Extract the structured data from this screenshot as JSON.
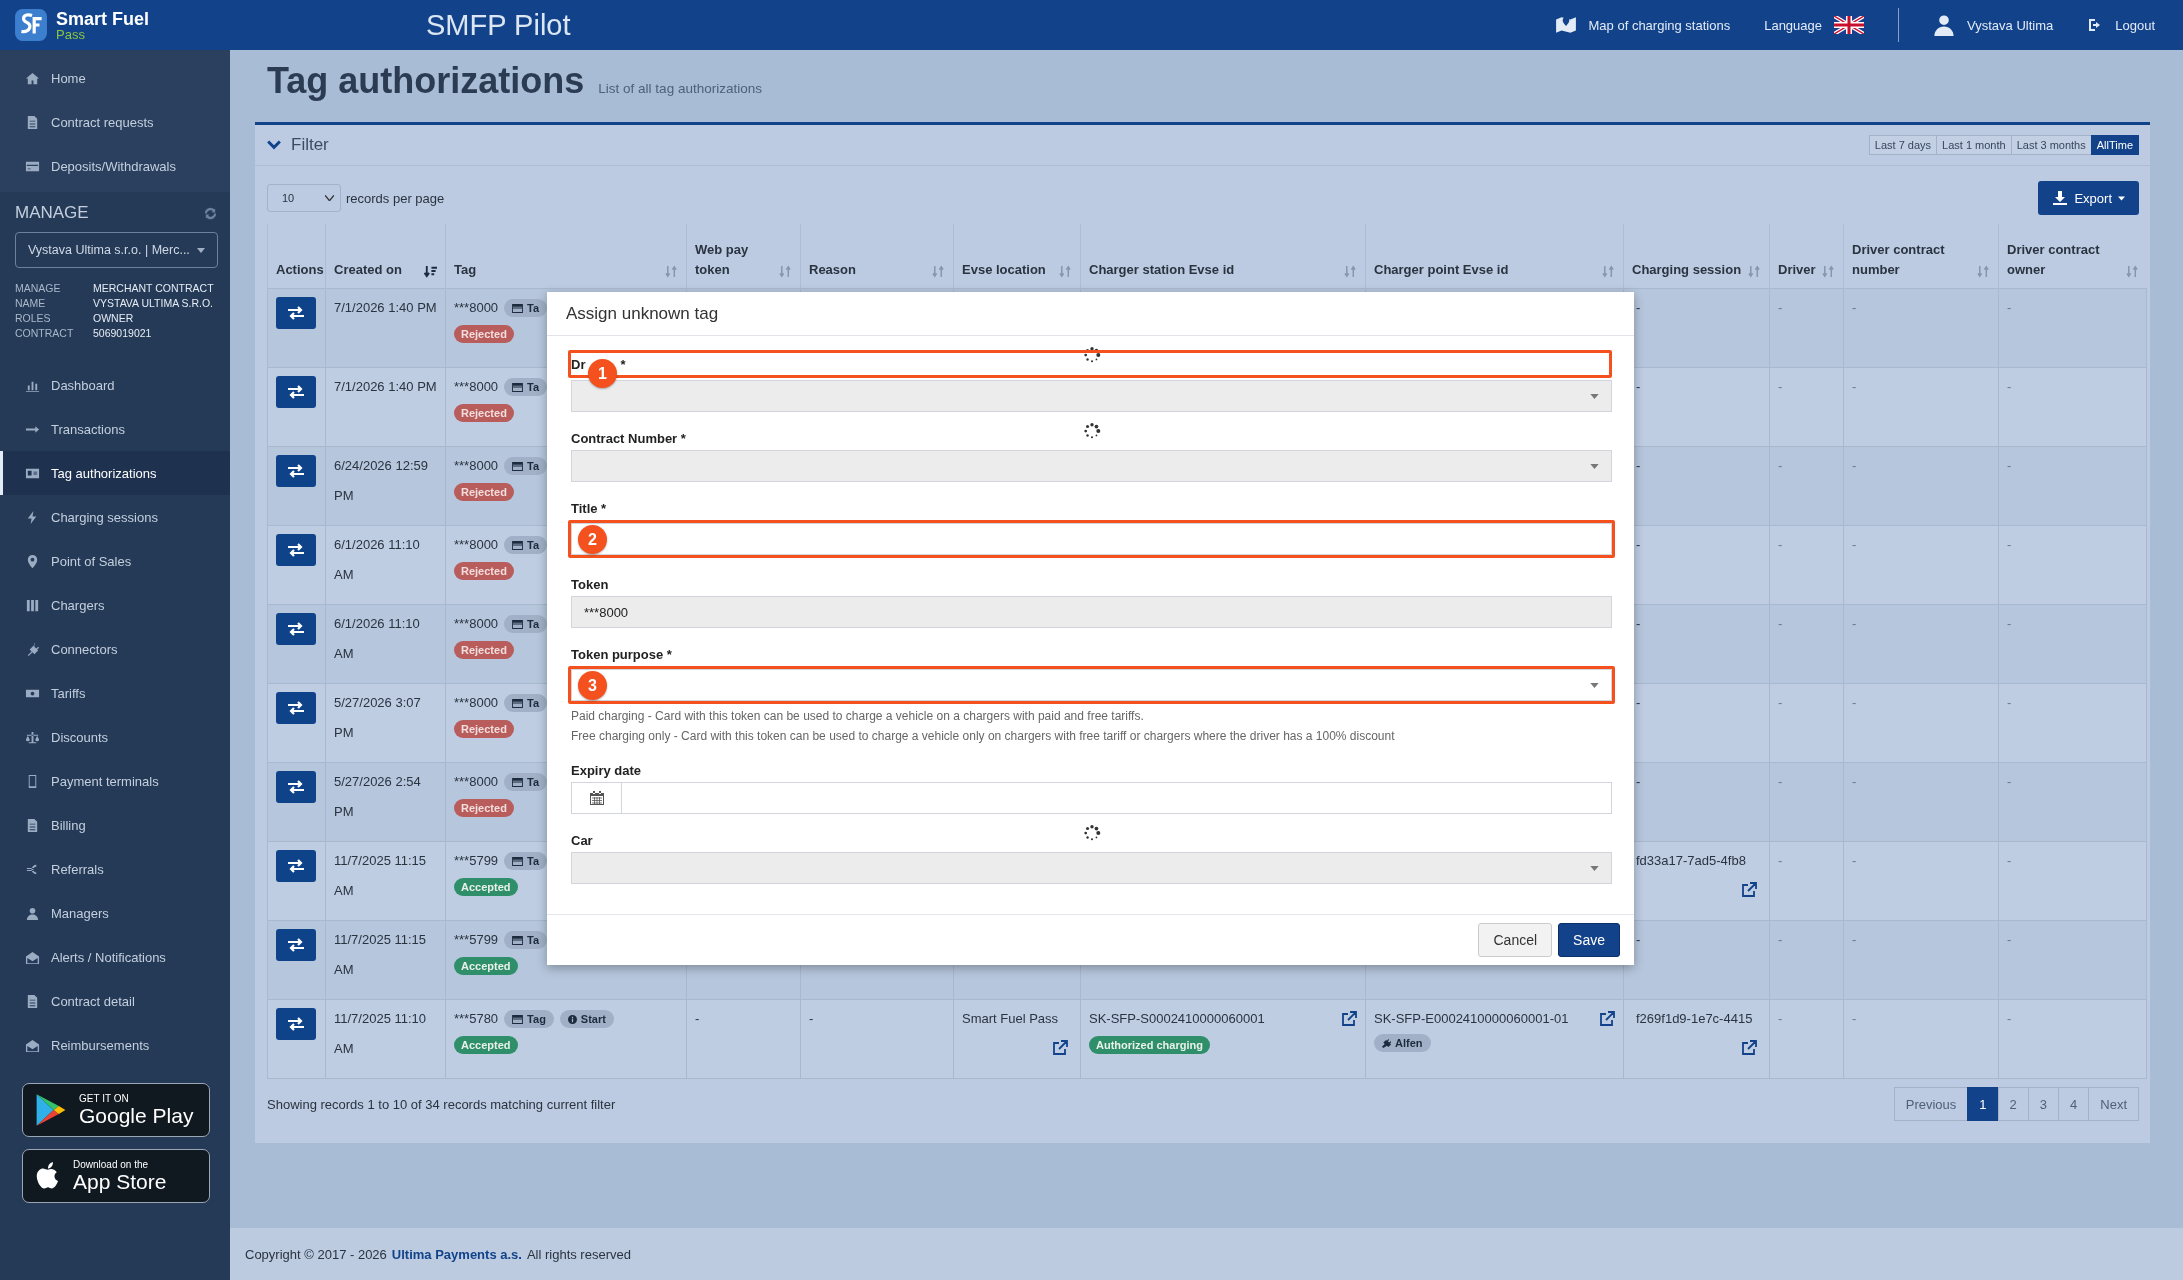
{
  "header": {
    "logo_line1": "Smart Fuel",
    "logo_line2": "Pass",
    "app_title": "SMFP Pilot",
    "map_link": "Map of charging stations",
    "language": "Language",
    "user": "Vystava Ultima",
    "logout": "Logout"
  },
  "sidebar": {
    "top_items": [
      {
        "label": "Home",
        "selected": false
      },
      {
        "label": "Contract requests",
        "selected": false
      },
      {
        "label": "Deposits/Withdrawals",
        "selected": false
      }
    ],
    "manage": {
      "title": "MANAGE",
      "select": "Vystava Ultima s.r.o. | Merc...",
      "info": [
        {
          "key": "MANAGE",
          "value": "MERCHANT CONTRACT"
        },
        {
          "key": "NAME",
          "value": "VYSTAVA ULTIMA S.R.O."
        },
        {
          "key": "ROLES",
          "value": "OWNER"
        },
        {
          "key": "CONTRACT",
          "value": "5069019021"
        }
      ]
    },
    "items": [
      {
        "label": "Dashboard",
        "selected": false
      },
      {
        "label": "Transactions",
        "selected": false
      },
      {
        "label": "Tag authorizations",
        "selected": true
      },
      {
        "label": "Charging sessions",
        "selected": false
      },
      {
        "label": "Point of Sales",
        "selected": false
      },
      {
        "label": "Chargers",
        "selected": false
      },
      {
        "label": "Connectors",
        "selected": false
      },
      {
        "label": "Tariffs",
        "selected": false
      },
      {
        "label": "Discounts",
        "selected": false
      },
      {
        "label": "Payment terminals",
        "selected": false
      },
      {
        "label": "Billing",
        "selected": false
      },
      {
        "label": "Referrals",
        "selected": false
      },
      {
        "label": "Managers",
        "selected": false
      },
      {
        "label": "Alerts / Notifications",
        "selected": false
      },
      {
        "label": "Contract detail",
        "selected": false
      },
      {
        "label": "Reimbursements",
        "selected": false
      }
    ],
    "stores": [
      {
        "kind": "google",
        "line1": "GET IT ON",
        "line2": "Google Play"
      },
      {
        "kind": "apple",
        "line1": "Download on the",
        "line2": "App Store"
      }
    ]
  },
  "page": {
    "title": "Tag authorizations",
    "subtitle": "List of all tag authorizations"
  },
  "filter": {
    "label": "Filter",
    "ranges": [
      {
        "label": "Last 7 days",
        "selected": false
      },
      {
        "label": "Last 1 month",
        "selected": false
      },
      {
        "label": "Last 3 months",
        "selected": false
      },
      {
        "label": "AllTime",
        "selected": true
      }
    ]
  },
  "records": {
    "value": "10",
    "label": "records per page"
  },
  "export": "Export",
  "table": {
    "columns": [
      {
        "label": "Actions",
        "sortable": false
      },
      {
        "label": "Created on",
        "sortable": true,
        "sorted": true
      },
      {
        "label": "Tag",
        "sortable": true,
        "sorted": false
      },
      {
        "label": "Web pay token",
        "sortable": true,
        "sorted": false
      },
      {
        "label": "Reason",
        "sortable": true,
        "sorted": false
      },
      {
        "label": "Evse location",
        "sortable": true,
        "sorted": false
      },
      {
        "label": "Charger station Evse id",
        "sortable": true,
        "sorted": false
      },
      {
        "label": "Charger point Evse id",
        "sortable": true,
        "sorted": false
      },
      {
        "label": "Charging session",
        "sortable": true,
        "sorted": false
      },
      {
        "label": "Driver",
        "sortable": true,
        "sorted": false
      },
      {
        "label": "Driver contract number",
        "sortable": true,
        "sorted": false
      },
      {
        "label": "Driver contract owner",
        "sortable": true,
        "sorted": false
      }
    ],
    "rows": [
      {
        "created": "7/1/2026 1:40 PM",
        "tag": "***8000",
        "chips": [
          {
            "kind": "tag",
            "label": "Ta"
          }
        ],
        "status": {
          "kind": "rejected",
          "label": "Rejected"
        },
        "session": {
          "text": "-",
          "link": false
        },
        "driver": "-",
        "contract_number": "-",
        "contract_owner": "-"
      },
      {
        "created": "7/1/2026 1:40 PM",
        "tag": "***8000",
        "chips": [
          {
            "kind": "tag",
            "label": "Ta"
          }
        ],
        "status": {
          "kind": "rejected",
          "label": "Rejected"
        },
        "session": {
          "text": "-",
          "link": false
        },
        "driver": "-",
        "contract_number": "-",
        "contract_owner": "-"
      },
      {
        "created": "6/24/2026 12:59 PM",
        "tag": "***8000",
        "chips": [
          {
            "kind": "tag",
            "label": "Ta"
          }
        ],
        "status": {
          "kind": "rejected",
          "label": "Rejected"
        },
        "session": {
          "text": "-",
          "link": false
        },
        "driver": "-",
        "contract_number": "-",
        "contract_owner": "-"
      },
      {
        "created": "6/1/2026 11:10 AM",
        "tag": "***8000",
        "chips": [
          {
            "kind": "tag",
            "label": "Ta"
          }
        ],
        "status": {
          "kind": "rejected",
          "label": "Rejected"
        },
        "session": {
          "text": "-",
          "link": false
        },
        "driver": "-",
        "contract_number": "-",
        "contract_owner": "-"
      },
      {
        "created": "6/1/2026 11:10 AM",
        "tag": "***8000",
        "chips": [
          {
            "kind": "tag",
            "label": "Ta"
          }
        ],
        "status": {
          "kind": "rejected",
          "label": "Rejected"
        },
        "session": {
          "text": "-",
          "link": false
        },
        "driver": "-",
        "contract_number": "-",
        "contract_owner": "-"
      },
      {
        "created": "5/27/2026 3:07 PM",
        "tag": "***8000",
        "chips": [
          {
            "kind": "tag",
            "label": "Ta"
          }
        ],
        "status": {
          "kind": "rejected",
          "label": "Rejected"
        },
        "session": {
          "text": "-",
          "link": false
        },
        "driver": "-",
        "contract_number": "-",
        "contract_owner": "-"
      },
      {
        "created": "5/27/2026 2:54 PM",
        "tag": "***8000",
        "chips": [
          {
            "kind": "tag",
            "label": "Ta"
          }
        ],
        "status": {
          "kind": "rejected",
          "label": "Rejected"
        },
        "session": {
          "text": "-",
          "link": false
        },
        "driver": "-",
        "contract_number": "-",
        "contract_owner": "-"
      },
      {
        "created": "11/7/2025 11:15 AM",
        "tag": "***5799",
        "chips": [
          {
            "kind": "tag",
            "label": "Ta"
          }
        ],
        "status": {
          "kind": "accepted",
          "label": "Accepted"
        },
        "session": {
          "text": "fd33a17-7ad5-4fb8",
          "link": true
        },
        "driver": "-",
        "contract_number": "-",
        "contract_owner": "-"
      },
      {
        "created": "11/7/2025 11:15 AM",
        "tag": "***5799",
        "chips": [
          {
            "kind": "tag",
            "label": "Ta"
          }
        ],
        "status": {
          "kind": "accepted",
          "label": "Accepted"
        },
        "session": {
          "text": "-",
          "link": false
        },
        "driver": "-",
        "contract_number": "-",
        "contract_owner": "-"
      },
      {
        "created": "11/7/2025 11:10 AM",
        "tag": "***5780",
        "chips": [
          {
            "kind": "tag",
            "label": "Tag"
          },
          {
            "kind": "start",
            "label": "Start"
          }
        ],
        "status": {
          "kind": "accepted",
          "label": "Accepted"
        },
        "web_pay": "-",
        "reason": "-",
        "evse_location": {
          "text": "Smart Fuel Pass",
          "link": true
        },
        "station": {
          "text": "SK-SFP-S0002410000060001",
          "link": true,
          "badge": "Authorized charging"
        },
        "point": {
          "text": "SK-SFP-E0002410000060001-01",
          "link": true,
          "chip": "Alfen"
        },
        "session": {
          "text": "f269f1d9-1e7c-4415",
          "link": true
        },
        "driver": "-",
        "contract_number": "-",
        "contract_owner": "-"
      }
    ]
  },
  "summary": "Showing records 1 to 10 of 34 records matching current filter",
  "pagination": [
    {
      "label": "Previous",
      "selected": false
    },
    {
      "label": "1",
      "selected": true
    },
    {
      "label": "2",
      "selected": false
    },
    {
      "label": "3",
      "selected": false
    },
    {
      "label": "4",
      "selected": false
    },
    {
      "label": "Next",
      "selected": false
    }
  ],
  "footer": {
    "prefix": "Copyright © 2017 - 2026",
    "link": "Ultima Payments a.s.",
    "suffix": "All rights reserved"
  },
  "modal": {
    "title": "Assign unknown tag",
    "fields": [
      {
        "kind": "select",
        "label": "Dr",
        "label_tail": "*",
        "disabled": true,
        "loading": true,
        "label_marker": "1"
      },
      {
        "kind": "select",
        "label": "Contract Number *",
        "disabled": true,
        "loading": true
      },
      {
        "kind": "text",
        "label": "Title *",
        "disabled": false,
        "loading": false,
        "control_marker": "2"
      },
      {
        "kind": "text",
        "label": "Token",
        "disabled": true,
        "loading": false,
        "value": "***8000"
      },
      {
        "kind": "select",
        "label": "Token purpose *",
        "disabled": false,
        "loading": false,
        "control_marker": "3",
        "help": [
          "Paid charging - Card with this token can be used to charge a vehicle on a chargers with paid and free tariffs.",
          "Free charging only - Card with this token can be used to charge a vehicle only on chargers with free tariff or chargers where the driver has a 100% discount"
        ]
      },
      {
        "kind": "date",
        "label": "Expiry date",
        "disabled": false,
        "loading": false
      },
      {
        "kind": "select",
        "label": "Car",
        "disabled": true,
        "loading": true
      }
    ],
    "buttons": [
      {
        "kind": "default",
        "label": "Cancel"
      },
      {
        "kind": "primary",
        "label": "Save"
      }
    ]
  }
}
